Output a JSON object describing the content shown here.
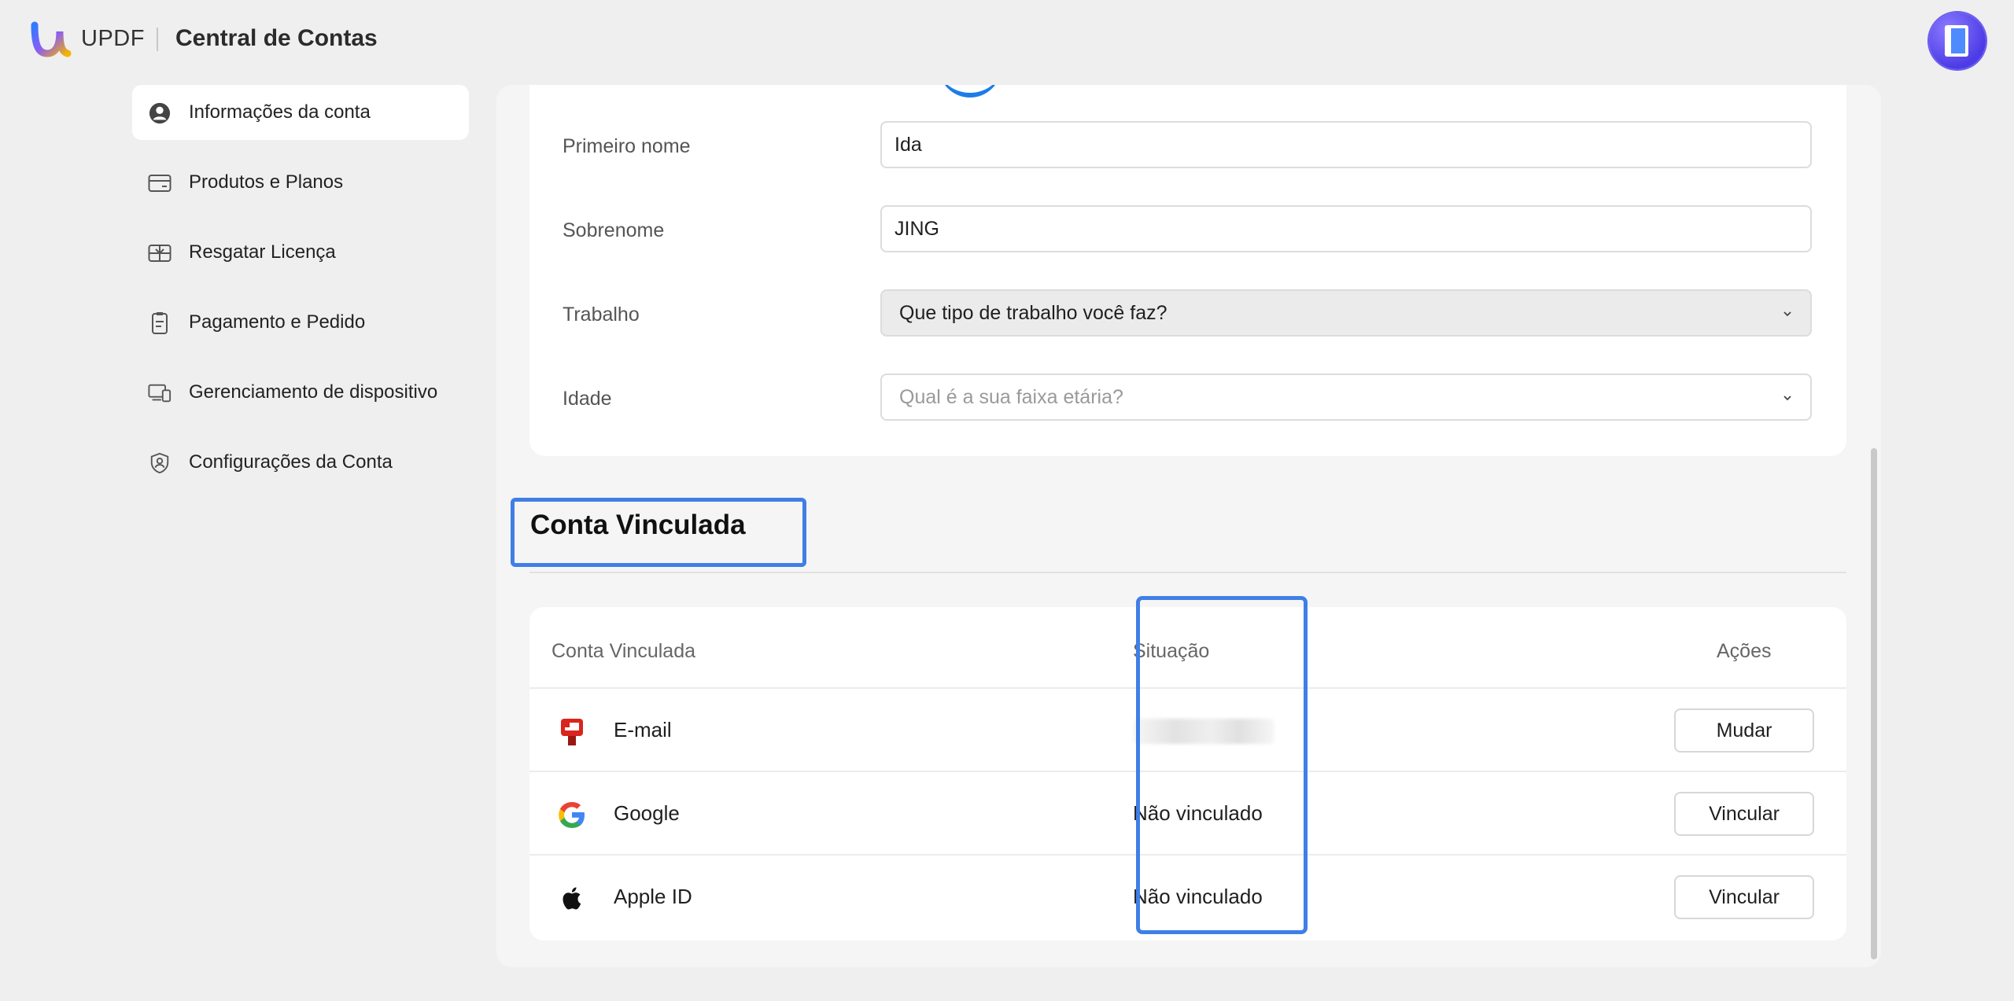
{
  "header": {
    "brand": "UPDF",
    "title": "Central de Contas"
  },
  "sidebar": {
    "items": [
      {
        "label": "Informações da conta",
        "icon": "user-circle-icon",
        "active": true
      },
      {
        "label": "Produtos e Planos",
        "icon": "card-icon"
      },
      {
        "label": "Resgatar Licença",
        "icon": "gift-card-icon"
      },
      {
        "label": "Pagamento e Pedido",
        "icon": "clipboard-icon"
      },
      {
        "label": "Gerenciamento de dispositivo",
        "icon": "devices-icon"
      },
      {
        "label": "Configurações da Conta",
        "icon": "shield-user-icon"
      }
    ]
  },
  "profile": {
    "first_name": {
      "label": "Primeiro nome",
      "value": "Ida"
    },
    "last_name": {
      "label": "Sobrenome",
      "value": "JING"
    },
    "job": {
      "label": "Trabalho",
      "value": "Que tipo de trabalho você faz?"
    },
    "age": {
      "label": "Idade",
      "placeholder": "Qual é a sua faixa etária?"
    }
  },
  "linked": {
    "title": "Conta Vinculada",
    "columns": {
      "account": "Conta Vinculada",
      "status": "Situação",
      "actions": "Ações"
    },
    "rows": [
      {
        "name": "E-mail",
        "icon": "mailbox-icon",
        "status": "",
        "action": "Mudar"
      },
      {
        "name": "Google",
        "icon": "google-icon",
        "status": "Não vinculado",
        "action": "Vincular"
      },
      {
        "name": "Apple ID",
        "icon": "apple-icon",
        "status": "Não vinculado",
        "action": "Vincular"
      }
    ]
  },
  "colors": {
    "highlight": "#3f7fe6",
    "avatar": "#4d3ce6"
  }
}
